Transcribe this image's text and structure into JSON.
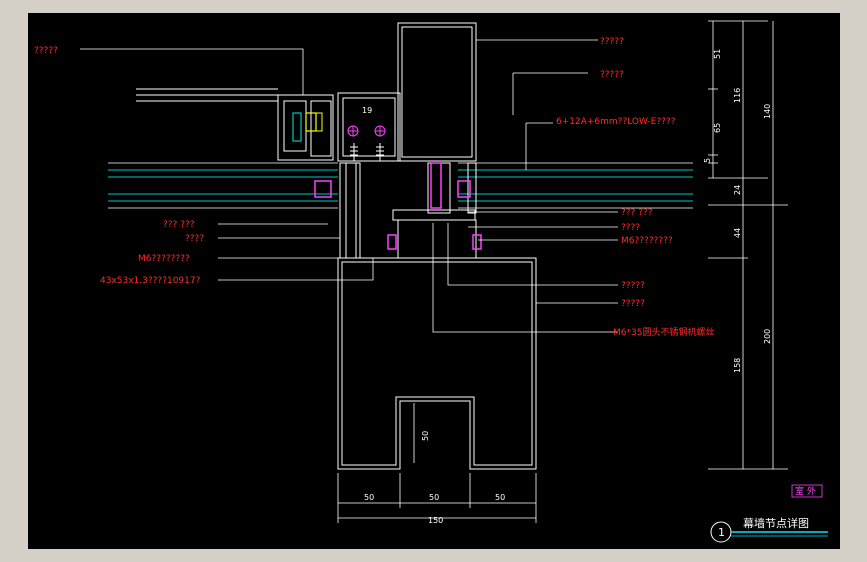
{
  "colors": {
    "background": "#000000",
    "frame": "#d4d0c8",
    "outline": "#ffffff",
    "leader": "#ffffff",
    "annotation": "#ff2a2a",
    "glass": "#00c8c8",
    "gasket": "#ff40ff",
    "sealant": "#ffff00",
    "title_underline": "#00e5ff"
  },
  "annotations_left": [
    "?????",
    "??? ???",
    "????",
    "M6????????",
    "43x53x1.3????10917?"
  ],
  "annotations_right": [
    "?????",
    "?????",
    "6+12A+6mm??LOW-E????",
    "??? ???",
    "????",
    "M6????????",
    "?????",
    "?????",
    "M6*35圆头不锈钢机螺丝"
  ],
  "dimensions_vertical_inner": [
    "51",
    "116",
    "65",
    "5",
    "24",
    "44",
    "158"
  ],
  "dimensions_vertical_outer": [
    "140",
    "200"
  ],
  "dimensions_other": [
    "19",
    "50"
  ],
  "dimensions_bottom": [
    "50",
    "50",
    "50",
    "150"
  ],
  "side_tag": "室 外",
  "title": {
    "number": "1",
    "text": "幕墙节点详图"
  }
}
